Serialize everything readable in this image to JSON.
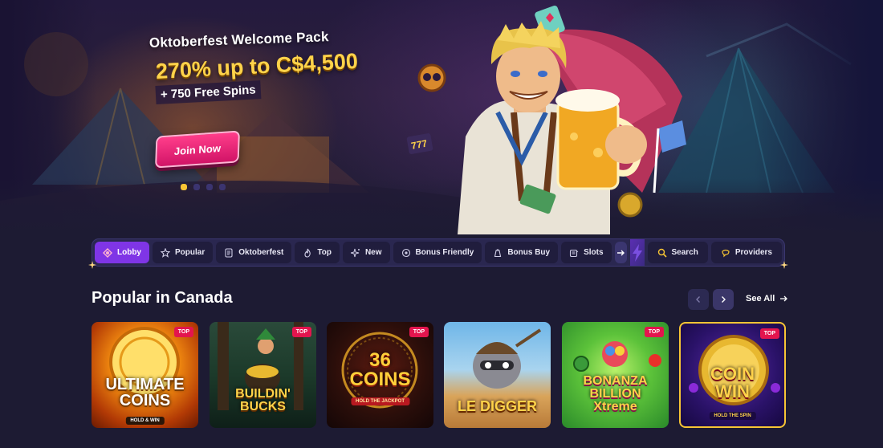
{
  "hero": {
    "subtitle": "Oktoberfest Welcome Pack",
    "headline_pct": "270%",
    "headline_up": " up to ",
    "headline_amount": "C$4,500",
    "spins": "+ 750 Free Spins",
    "cta": "Join Now",
    "slides": 4,
    "active_slide": 0
  },
  "nav": {
    "items": [
      {
        "label": "Lobby",
        "icon": "lobby-icon",
        "active": true
      },
      {
        "label": "Popular",
        "icon": "star-icon"
      },
      {
        "label": "Oktoberfest",
        "icon": "document-icon"
      },
      {
        "label": "Top",
        "icon": "flame-icon"
      },
      {
        "label": "New",
        "icon": "sparkle-icon"
      },
      {
        "label": "Bonus Friendly",
        "icon": "bonus-icon"
      },
      {
        "label": "Bonus Buy",
        "icon": "bag-icon"
      },
      {
        "label": "Slots",
        "icon": "slots-icon"
      }
    ],
    "search": "Search",
    "providers": "Providers"
  },
  "section": {
    "title": "Popular in Canada",
    "see_all": "See All"
  },
  "games": [
    {
      "title": "ULTIMATE COINS",
      "sub": "HOLD & WIN",
      "badge": "TOP"
    },
    {
      "title": "BUILDIN' BUCKS",
      "sub": "",
      "badge": "TOP"
    },
    {
      "title": "36 COINS",
      "sub": "HOLD THE JACKPOT",
      "badge": "TOP"
    },
    {
      "title": "LE DIGGER",
      "sub": "",
      "badge": ""
    },
    {
      "title": "BONANZA BILLION Xtreme",
      "sub": "",
      "badge": "TOP"
    },
    {
      "title": "COIN WIN",
      "sub": "HOLD THE SPIN",
      "badge": "TOP"
    }
  ],
  "colors": {
    "background": "#1d1b33",
    "accent_purple": "#7f35e6",
    "gold": "#ffd34a",
    "cta_pink": "#e31a73",
    "badge_red": "#e3154e"
  }
}
